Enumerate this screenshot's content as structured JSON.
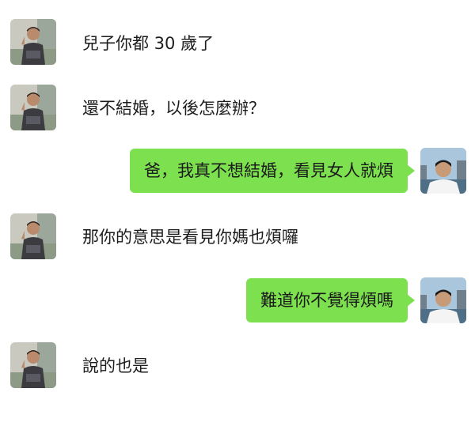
{
  "theme": {
    "bubble_color": "#7de04f"
  },
  "messages": [
    {
      "side": "left",
      "avatar": "father-avatar",
      "text": "兒子你都 30 歲了"
    },
    {
      "side": "left",
      "avatar": "father-avatar",
      "text": "還不結婚，以後怎麼辦？"
    },
    {
      "side": "right",
      "avatar": "son-avatar",
      "text": "爸，我真不想結婚，看見女人就煩"
    },
    {
      "side": "left",
      "avatar": "father-avatar",
      "text": "那你的意思是看見你媽也煩囉"
    },
    {
      "side": "right",
      "avatar": "son-avatar",
      "text": "難道你不覺得煩嗎"
    },
    {
      "side": "left",
      "avatar": "father-avatar",
      "text": "說的也是"
    }
  ]
}
